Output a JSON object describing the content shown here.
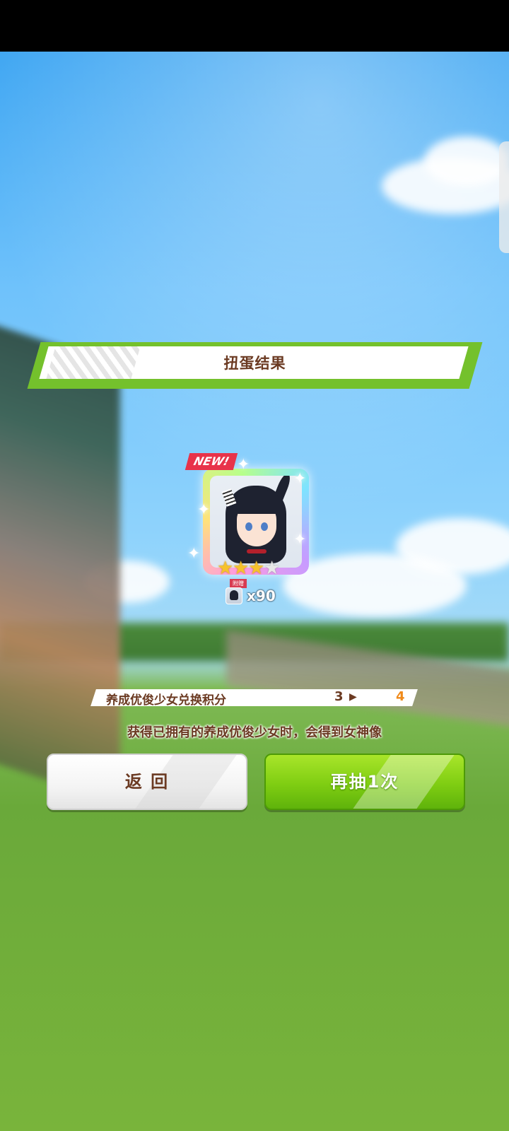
{
  "dialog": {
    "title": "扭蛋结果"
  },
  "result": {
    "new_badge": "NEW!",
    "rarity_stars": 3,
    "rarity_max": 5,
    "bonus_tag": "附赠",
    "bonus_count": "x90"
  },
  "points": {
    "label": "养成优俊少女兑换积分",
    "old_value": "3",
    "new_value": "4"
  },
  "info_text": "获得已拥有的养成优俊少女时，会得到女神像",
  "buttons": {
    "back_label": "返 回",
    "again_label": "再抽1次"
  },
  "colors": {
    "accent_green": "#74c12c",
    "text_brown": "#6b3a22",
    "new_badge_red": "#e8334a",
    "points_new_orange": "#f08a1a",
    "star_gold": "#f6c22c"
  },
  "icons": {
    "sparkle": "sparkle-icon",
    "star": "star-icon",
    "arrow": "arrow-right-icon"
  }
}
